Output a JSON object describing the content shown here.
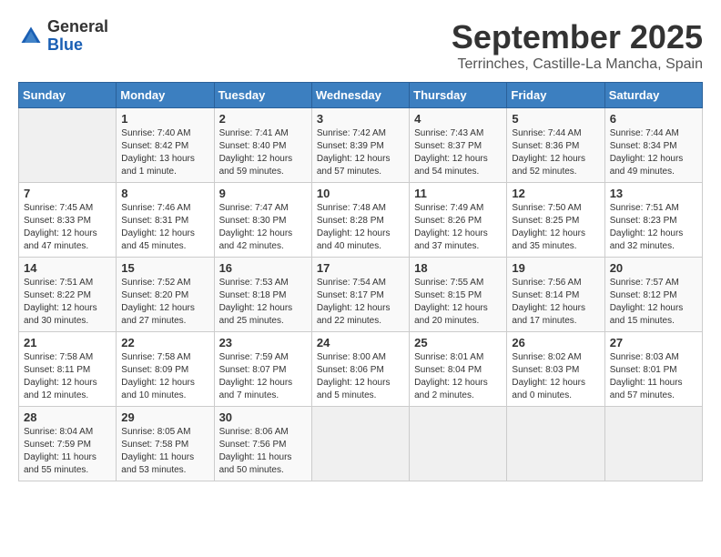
{
  "logo": {
    "general": "General",
    "blue": "Blue"
  },
  "title": "September 2025",
  "location": "Terrinches, Castille-La Mancha, Spain",
  "days_of_week": [
    "Sunday",
    "Monday",
    "Tuesday",
    "Wednesday",
    "Thursday",
    "Friday",
    "Saturday"
  ],
  "weeks": [
    [
      {
        "day": "",
        "info": ""
      },
      {
        "day": "1",
        "info": "Sunrise: 7:40 AM\nSunset: 8:42 PM\nDaylight: 13 hours\nand 1 minute."
      },
      {
        "day": "2",
        "info": "Sunrise: 7:41 AM\nSunset: 8:40 PM\nDaylight: 12 hours\nand 59 minutes."
      },
      {
        "day": "3",
        "info": "Sunrise: 7:42 AM\nSunset: 8:39 PM\nDaylight: 12 hours\nand 57 minutes."
      },
      {
        "day": "4",
        "info": "Sunrise: 7:43 AM\nSunset: 8:37 PM\nDaylight: 12 hours\nand 54 minutes."
      },
      {
        "day": "5",
        "info": "Sunrise: 7:44 AM\nSunset: 8:36 PM\nDaylight: 12 hours\nand 52 minutes."
      },
      {
        "day": "6",
        "info": "Sunrise: 7:44 AM\nSunset: 8:34 PM\nDaylight: 12 hours\nand 49 minutes."
      }
    ],
    [
      {
        "day": "7",
        "info": "Sunrise: 7:45 AM\nSunset: 8:33 PM\nDaylight: 12 hours\nand 47 minutes."
      },
      {
        "day": "8",
        "info": "Sunrise: 7:46 AM\nSunset: 8:31 PM\nDaylight: 12 hours\nand 45 minutes."
      },
      {
        "day": "9",
        "info": "Sunrise: 7:47 AM\nSunset: 8:30 PM\nDaylight: 12 hours\nand 42 minutes."
      },
      {
        "day": "10",
        "info": "Sunrise: 7:48 AM\nSunset: 8:28 PM\nDaylight: 12 hours\nand 40 minutes."
      },
      {
        "day": "11",
        "info": "Sunrise: 7:49 AM\nSunset: 8:26 PM\nDaylight: 12 hours\nand 37 minutes."
      },
      {
        "day": "12",
        "info": "Sunrise: 7:50 AM\nSunset: 8:25 PM\nDaylight: 12 hours\nand 35 minutes."
      },
      {
        "day": "13",
        "info": "Sunrise: 7:51 AM\nSunset: 8:23 PM\nDaylight: 12 hours\nand 32 minutes."
      }
    ],
    [
      {
        "day": "14",
        "info": "Sunrise: 7:51 AM\nSunset: 8:22 PM\nDaylight: 12 hours\nand 30 minutes."
      },
      {
        "day": "15",
        "info": "Sunrise: 7:52 AM\nSunset: 8:20 PM\nDaylight: 12 hours\nand 27 minutes."
      },
      {
        "day": "16",
        "info": "Sunrise: 7:53 AM\nSunset: 8:18 PM\nDaylight: 12 hours\nand 25 minutes."
      },
      {
        "day": "17",
        "info": "Sunrise: 7:54 AM\nSunset: 8:17 PM\nDaylight: 12 hours\nand 22 minutes."
      },
      {
        "day": "18",
        "info": "Sunrise: 7:55 AM\nSunset: 8:15 PM\nDaylight: 12 hours\nand 20 minutes."
      },
      {
        "day": "19",
        "info": "Sunrise: 7:56 AM\nSunset: 8:14 PM\nDaylight: 12 hours\nand 17 minutes."
      },
      {
        "day": "20",
        "info": "Sunrise: 7:57 AM\nSunset: 8:12 PM\nDaylight: 12 hours\nand 15 minutes."
      }
    ],
    [
      {
        "day": "21",
        "info": "Sunrise: 7:58 AM\nSunset: 8:11 PM\nDaylight: 12 hours\nand 12 minutes."
      },
      {
        "day": "22",
        "info": "Sunrise: 7:58 AM\nSunset: 8:09 PM\nDaylight: 12 hours\nand 10 minutes."
      },
      {
        "day": "23",
        "info": "Sunrise: 7:59 AM\nSunset: 8:07 PM\nDaylight: 12 hours\nand 7 minutes."
      },
      {
        "day": "24",
        "info": "Sunrise: 8:00 AM\nSunset: 8:06 PM\nDaylight: 12 hours\nand 5 minutes."
      },
      {
        "day": "25",
        "info": "Sunrise: 8:01 AM\nSunset: 8:04 PM\nDaylight: 12 hours\nand 2 minutes."
      },
      {
        "day": "26",
        "info": "Sunrise: 8:02 AM\nSunset: 8:03 PM\nDaylight: 12 hours\nand 0 minutes."
      },
      {
        "day": "27",
        "info": "Sunrise: 8:03 AM\nSunset: 8:01 PM\nDaylight: 11 hours\nand 57 minutes."
      }
    ],
    [
      {
        "day": "28",
        "info": "Sunrise: 8:04 AM\nSunset: 7:59 PM\nDaylight: 11 hours\nand 55 minutes."
      },
      {
        "day": "29",
        "info": "Sunrise: 8:05 AM\nSunset: 7:58 PM\nDaylight: 11 hours\nand 53 minutes."
      },
      {
        "day": "30",
        "info": "Sunrise: 8:06 AM\nSunset: 7:56 PM\nDaylight: 11 hours\nand 50 minutes."
      },
      {
        "day": "",
        "info": ""
      },
      {
        "day": "",
        "info": ""
      },
      {
        "day": "",
        "info": ""
      },
      {
        "day": "",
        "info": ""
      }
    ]
  ]
}
